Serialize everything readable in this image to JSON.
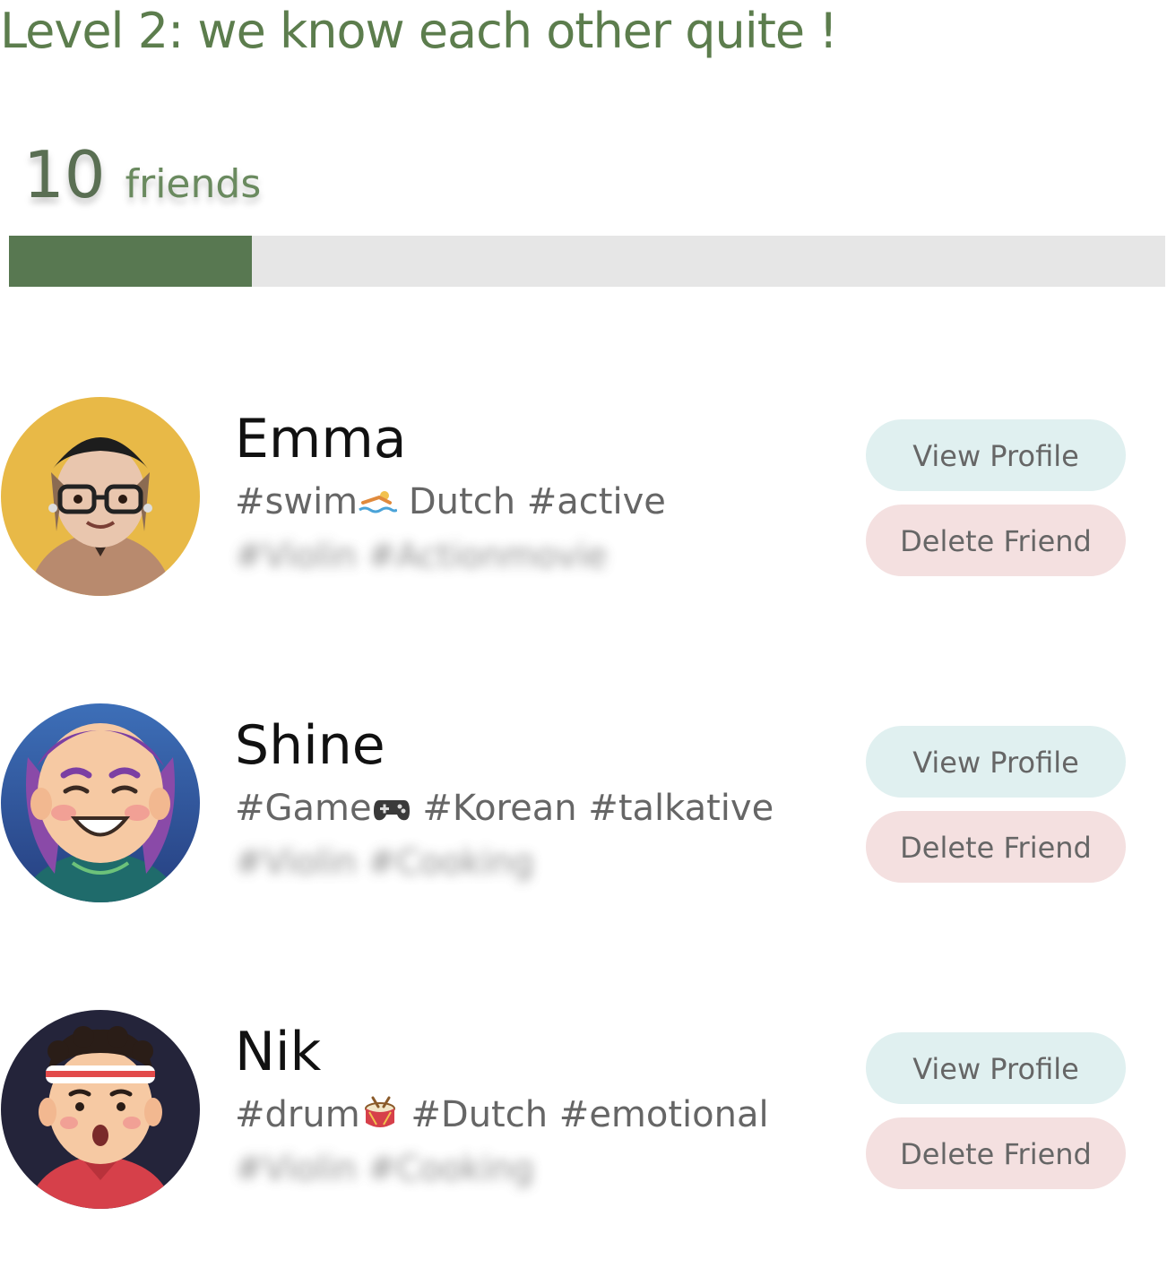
{
  "header": {
    "level_title": "Level 2: we know each other quite !"
  },
  "friend_count": {
    "number": "10",
    "label": "friends",
    "progress_fraction": 0.21
  },
  "colors": {
    "accent_green": "#587851",
    "view_button_bg": "#e0f0f0",
    "delete_button_bg": "#f4e0e0"
  },
  "friends": [
    {
      "name": "Emma",
      "tags_before_icon": "#swim",
      "tag_icon": "swimmer-icon",
      "tags_after_icon": " Dutch #active",
      "hidden_tags": "#Violin #Actionmovie",
      "avatar_icon": "avatar-emma",
      "avatar_bg": "#e8b947",
      "view_label": "View Profile",
      "delete_label": "Delete Friend"
    },
    {
      "name": "Shine",
      "tags_before_icon": "#Game",
      "tag_icon": "gamepad-icon",
      "tags_after_icon": " #Korean #talkative",
      "hidden_tags": "#Violin #Cooking",
      "avatar_icon": "avatar-shine",
      "avatar_bg": "#2f5fa0",
      "view_label": "View Profile",
      "delete_label": "Delete Friend"
    },
    {
      "name": "Nik",
      "tags_before_icon": "#drum",
      "tag_icon": "drum-icon",
      "tags_after_icon": " #Dutch #emotional",
      "hidden_tags": "#Violin #Cooking",
      "avatar_icon": "avatar-nik",
      "avatar_bg": "#24243a",
      "view_label": "View Profile",
      "delete_label": "Delete Friend"
    }
  ]
}
